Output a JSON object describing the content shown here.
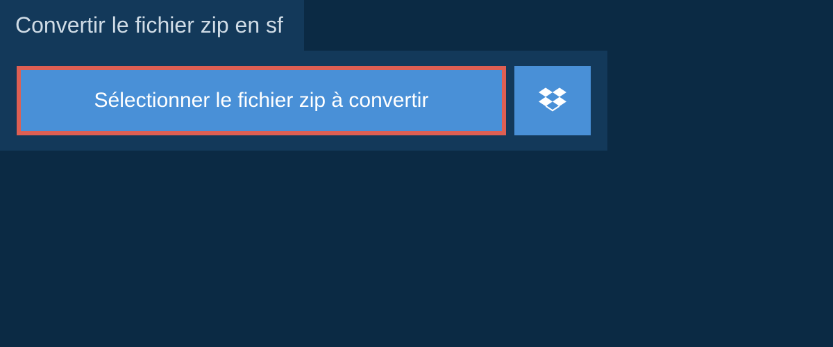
{
  "header": {
    "title": "Convertir le fichier zip en sf"
  },
  "upload": {
    "select_label": "Sélectionner le fichier zip à convertir"
  }
}
